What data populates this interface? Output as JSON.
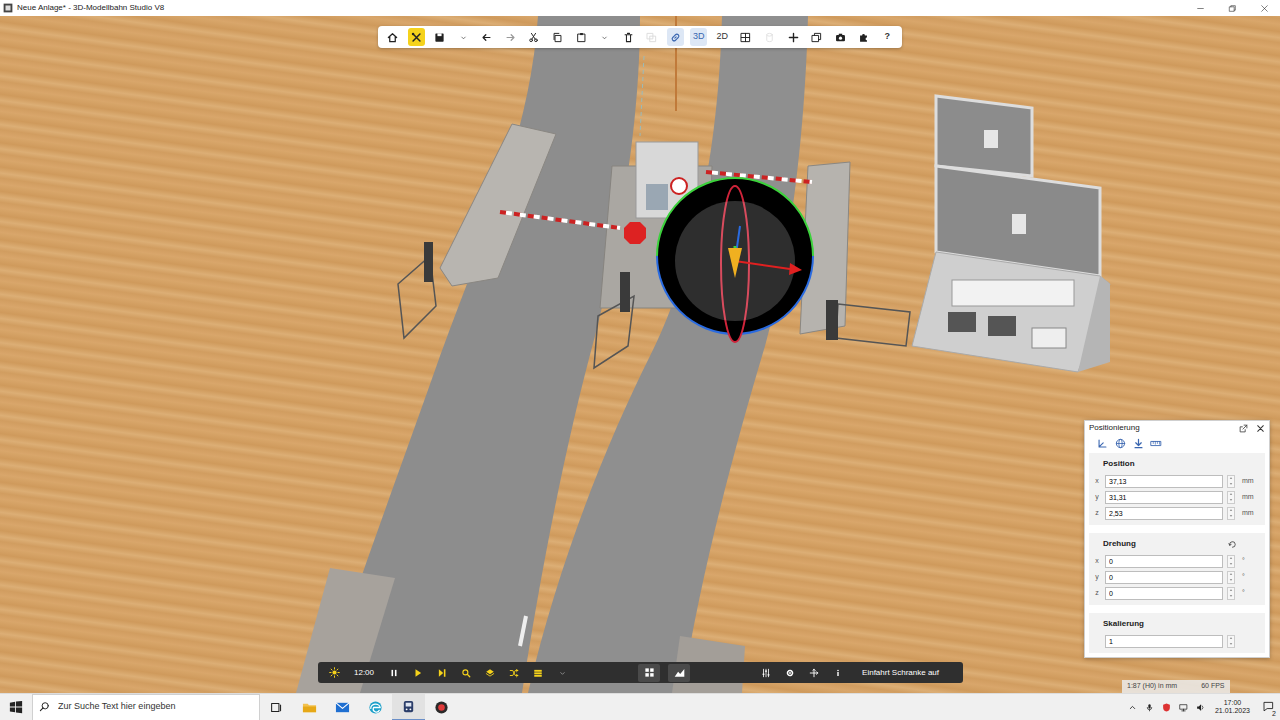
{
  "window": {
    "title": "Neue Anlage* - 3D-Modellbahn Studio V8"
  },
  "toolbar": {
    "tool_active": true,
    "link_active": true,
    "views": [
      {
        "label": "3D",
        "selected": true
      },
      {
        "label": "2D",
        "selected": false
      }
    ],
    "help": "?"
  },
  "bottom_bar": {
    "time": "12:00",
    "status": "Einfahrt Schranke auf"
  },
  "panel": {
    "title": "Positionierung",
    "position": {
      "label": "Position",
      "fields": [
        {
          "axis": "x",
          "value": "37,13",
          "unit": "mm"
        },
        {
          "axis": "y",
          "value": "31,31",
          "unit": "mm"
        },
        {
          "axis": "z",
          "value": "2,53",
          "unit": "mm"
        }
      ]
    },
    "rotation": {
      "label": "Drehung",
      "fields": [
        {
          "axis": "x",
          "value": "0",
          "unit": "°"
        },
        {
          "axis": "y",
          "value": "0",
          "unit": "°"
        },
        {
          "axis": "z",
          "value": "0",
          "unit": "°"
        }
      ]
    },
    "scale": {
      "label": "Skalierung",
      "value": "1"
    }
  },
  "status_info": {
    "scale": "1:87 (H0) in mm",
    "fps": "60 FPS"
  },
  "taskbar": {
    "search_placeholder": "Zur Suche Text hier eingeben",
    "time": "17:00",
    "date": "21.01.2023",
    "notifications": "2"
  }
}
